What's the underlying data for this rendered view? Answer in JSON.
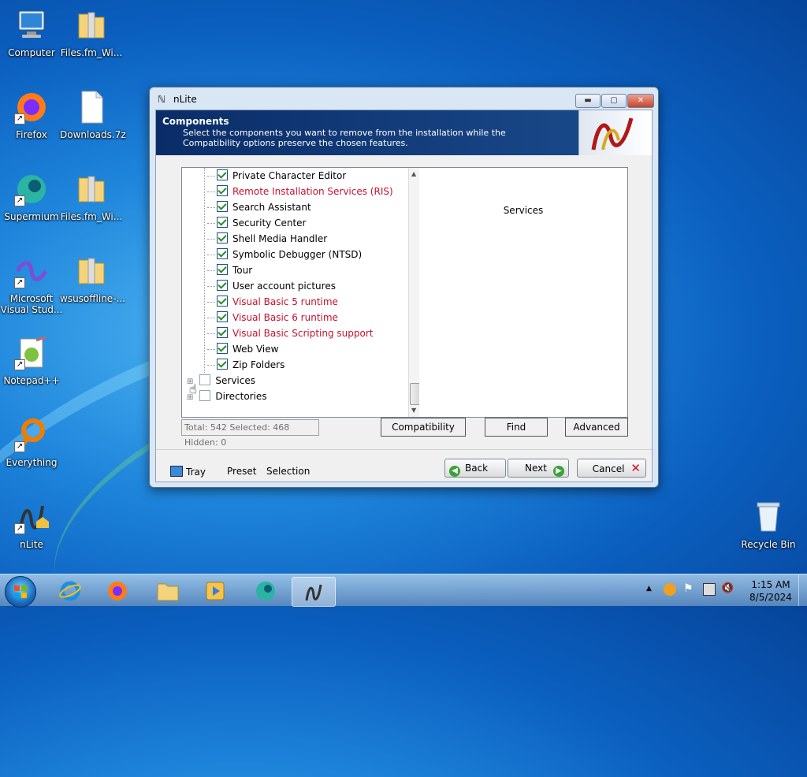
{
  "desktop": {
    "icons": [
      {
        "label": "Computer"
      },
      {
        "label": "Files.fm_Wi..."
      },
      {
        "label": "Firefox"
      },
      {
        "label": "Downloads.7z"
      },
      {
        "label": "Supermium"
      },
      {
        "label": "Files.fm_Wi..."
      },
      {
        "label": "Microsoft Visual Stud..."
      },
      {
        "label": "wsusoffline-..."
      },
      {
        "label": "Notepad++"
      },
      {
        "label": "Everything"
      },
      {
        "label": "nLite"
      },
      {
        "label": "Recycle Bin"
      }
    ]
  },
  "window": {
    "title": "nLite",
    "controls": {
      "minimize": "▬",
      "maximize": "▢",
      "close": "✕"
    },
    "banner": {
      "heading": "Components",
      "description": "Select the components you want to remove from the installation while the Compatibility options preserve the chosen features."
    },
    "tree": {
      "items": [
        {
          "label": "Private Character Editor",
          "checked": true,
          "red": false
        },
        {
          "label": "Remote Installation Services (RIS)",
          "checked": true,
          "red": true
        },
        {
          "label": "Search Assistant",
          "checked": true,
          "red": false
        },
        {
          "label": "Security Center",
          "checked": true,
          "red": false
        },
        {
          "label": "Shell Media Handler",
          "checked": true,
          "red": false
        },
        {
          "label": "Symbolic Debugger (NTSD)",
          "checked": true,
          "red": false
        },
        {
          "label": "Tour",
          "checked": true,
          "red": false
        },
        {
          "label": "User account pictures",
          "checked": true,
          "red": false
        },
        {
          "label": "Visual Basic 5 runtime",
          "checked": true,
          "red": true
        },
        {
          "label": "Visual Basic 6 runtime",
          "checked": true,
          "red": true
        },
        {
          "label": "Visual Basic Scripting support",
          "checked": true,
          "red": true
        },
        {
          "label": "Web View",
          "checked": true,
          "red": false
        },
        {
          "label": "Zip Folders",
          "checked": true,
          "red": false
        }
      ],
      "groups": [
        {
          "label": "Services",
          "checked": false
        },
        {
          "label": "Directories",
          "checked": false
        }
      ]
    },
    "description_panel": {
      "title": "Services"
    },
    "status": "Total: 542 Selected: 468 Hidden: 0",
    "buttons": {
      "compatibility": "Compatibility",
      "find": "Find",
      "advanced": "Advanced"
    },
    "footer": {
      "tray": "Tray",
      "preset": "Preset",
      "selection": "Selection",
      "back": "Back",
      "next": "Next",
      "cancel": "Cancel"
    }
  },
  "taskbar": {
    "time": "1:15 AM",
    "date": "8/5/2024"
  },
  "colors": {
    "banner": "#0a2d68",
    "red_item": "#c8102e",
    "check": "#2a8a2a"
  }
}
